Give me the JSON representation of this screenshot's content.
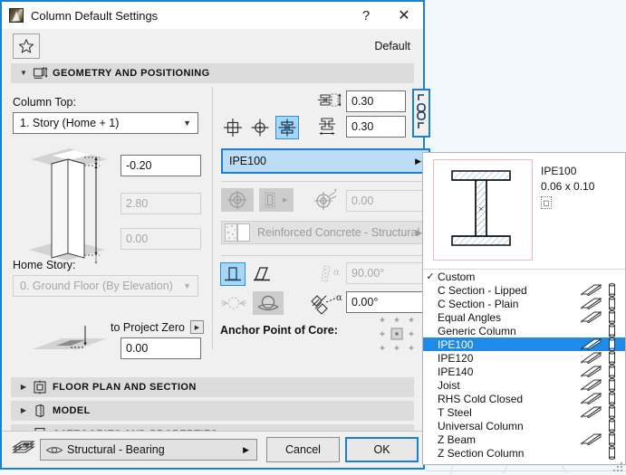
{
  "window": {
    "title": "Column Default Settings",
    "app_icon": "archicad-logo-icon",
    "help_label": "?",
    "close_label": "✕"
  },
  "favorites": {
    "star_icon": "star-icon",
    "default_label": "Default"
  },
  "sections": [
    {
      "id": "geometry",
      "label": "GEOMETRY AND POSITIONING",
      "icon": "column-height-icon",
      "expanded": true,
      "triangle": "▼"
    },
    {
      "id": "floor-plan",
      "label": "FLOOR PLAN AND SECTION",
      "icon": "floor-plan-icon",
      "expanded": false,
      "triangle": "▶"
    },
    {
      "id": "model",
      "label": "MODEL",
      "icon": "model-icon",
      "expanded": false,
      "triangle": "▶"
    },
    {
      "id": "categories",
      "label": "CATEGORIES AND PROPERTIES",
      "icon": "properties-icon",
      "expanded": false,
      "triangle": "▶"
    }
  ],
  "geometry": {
    "column_top_label": "Column Top:",
    "column_top_value": "1. Story (Home + 1)",
    "top_offset_value": "-0.20",
    "height_value": "2.80",
    "bottom_offset_value": "0.00",
    "home_story_label": "Home Story:",
    "home_story_value": "0. Ground Floor (By Elevation)",
    "to_project_zero_label": "to Project Zero",
    "project_zero_value": "0.00",
    "shape_buttons": [
      {
        "name": "rectangular-column-icon",
        "selected": false
      },
      {
        "name": "circular-column-icon",
        "selected": false
      },
      {
        "name": "complex-profile-column-icon",
        "selected": true
      }
    ],
    "dimension_fields": [
      {
        "icon": "column-depth-icon",
        "value": "0.30"
      },
      {
        "icon": "column-width-icon",
        "value": "0.30"
      }
    ],
    "link_button": {
      "name": "link-proportions-icon",
      "selected": true
    },
    "profile_name": "IPE100",
    "profile_arrow": "▶",
    "veneer_buttons": [
      {
        "name": "core-only-icon",
        "enabled": false
      },
      {
        "name": "veneer-icon",
        "enabled": false
      }
    ],
    "veneer_thickness_icon": "veneer-thickness-icon",
    "veneer_thickness_value": "0.00",
    "material_icon": "building-material-icon",
    "material_value": "Reinforced Concrete - Structural",
    "material_arrow": "▶",
    "taper_buttons": [
      {
        "name": "straight-column-icon",
        "selected": true
      },
      {
        "name": "slanted-column-icon",
        "selected": false
      }
    ],
    "slant_angle_icon": "slant-angle-icon",
    "slant_angle_value": "90.00°",
    "cross_section_buttons": [
      {
        "name": "cross-section-off-icon",
        "selected": false
      },
      {
        "name": "cross-section-on-icon",
        "selected": true
      }
    ],
    "rotation_icon": "rotation-angle-icon",
    "rotation_value": "0.00°",
    "anchor_label": "Anchor Point of Core:",
    "anchor_grid_icon": "anchor-point-grid-icon"
  },
  "profile_popup": {
    "preview": {
      "shape_icon": "i-beam-section-icon",
      "name": "IPE100",
      "dimensions": "0.06 x 0.10",
      "badge_icon": "profile-badge-icon"
    },
    "items": [
      {
        "label": "Custom",
        "checked": true,
        "selected": false,
        "beam_icon": false,
        "column_icon": false
      },
      {
        "label": "C Section - Lipped",
        "checked": false,
        "selected": false,
        "beam_icon": true,
        "column_icon": true
      },
      {
        "label": "C Section - Plain",
        "checked": false,
        "selected": false,
        "beam_icon": true,
        "column_icon": true
      },
      {
        "label": "Equal Angles",
        "checked": false,
        "selected": false,
        "beam_icon": true,
        "column_icon": true
      },
      {
        "label": "Generic Column",
        "checked": false,
        "selected": false,
        "beam_icon": false,
        "column_icon": true
      },
      {
        "label": "IPE100",
        "checked": false,
        "selected": true,
        "beam_icon": true,
        "column_icon": true
      },
      {
        "label": "IPE120",
        "checked": false,
        "selected": false,
        "beam_icon": true,
        "column_icon": true
      },
      {
        "label": "IPE140",
        "checked": false,
        "selected": false,
        "beam_icon": true,
        "column_icon": true
      },
      {
        "label": "Joist",
        "checked": false,
        "selected": false,
        "beam_icon": true,
        "column_icon": true
      },
      {
        "label": "RHS Cold Closed",
        "checked": false,
        "selected": false,
        "beam_icon": true,
        "column_icon": true
      },
      {
        "label": "T Steel",
        "checked": false,
        "selected": false,
        "beam_icon": true,
        "column_icon": true
      },
      {
        "label": "Universal Column",
        "checked": false,
        "selected": false,
        "beam_icon": false,
        "column_icon": true
      },
      {
        "label": "Z Beam",
        "checked": false,
        "selected": false,
        "beam_icon": true,
        "column_icon": true
      },
      {
        "label": "Z Section Column",
        "checked": false,
        "selected": false,
        "beam_icon": false,
        "column_icon": true
      }
    ]
  },
  "footer": {
    "layers_icon": "layers-icon",
    "layer_eye_icon": "eye-icon",
    "layer_value": "Structural - Bearing",
    "layer_arrow": "▶",
    "cancel_label": "Cancel",
    "ok_label": "OK"
  },
  "colors": {
    "accent": "#1d7fd1",
    "selection": "#1f8ae8",
    "highlight": "#bcddf5",
    "dialog_bg": "#f0f0f0",
    "section_bg": "#dcdcdc"
  }
}
